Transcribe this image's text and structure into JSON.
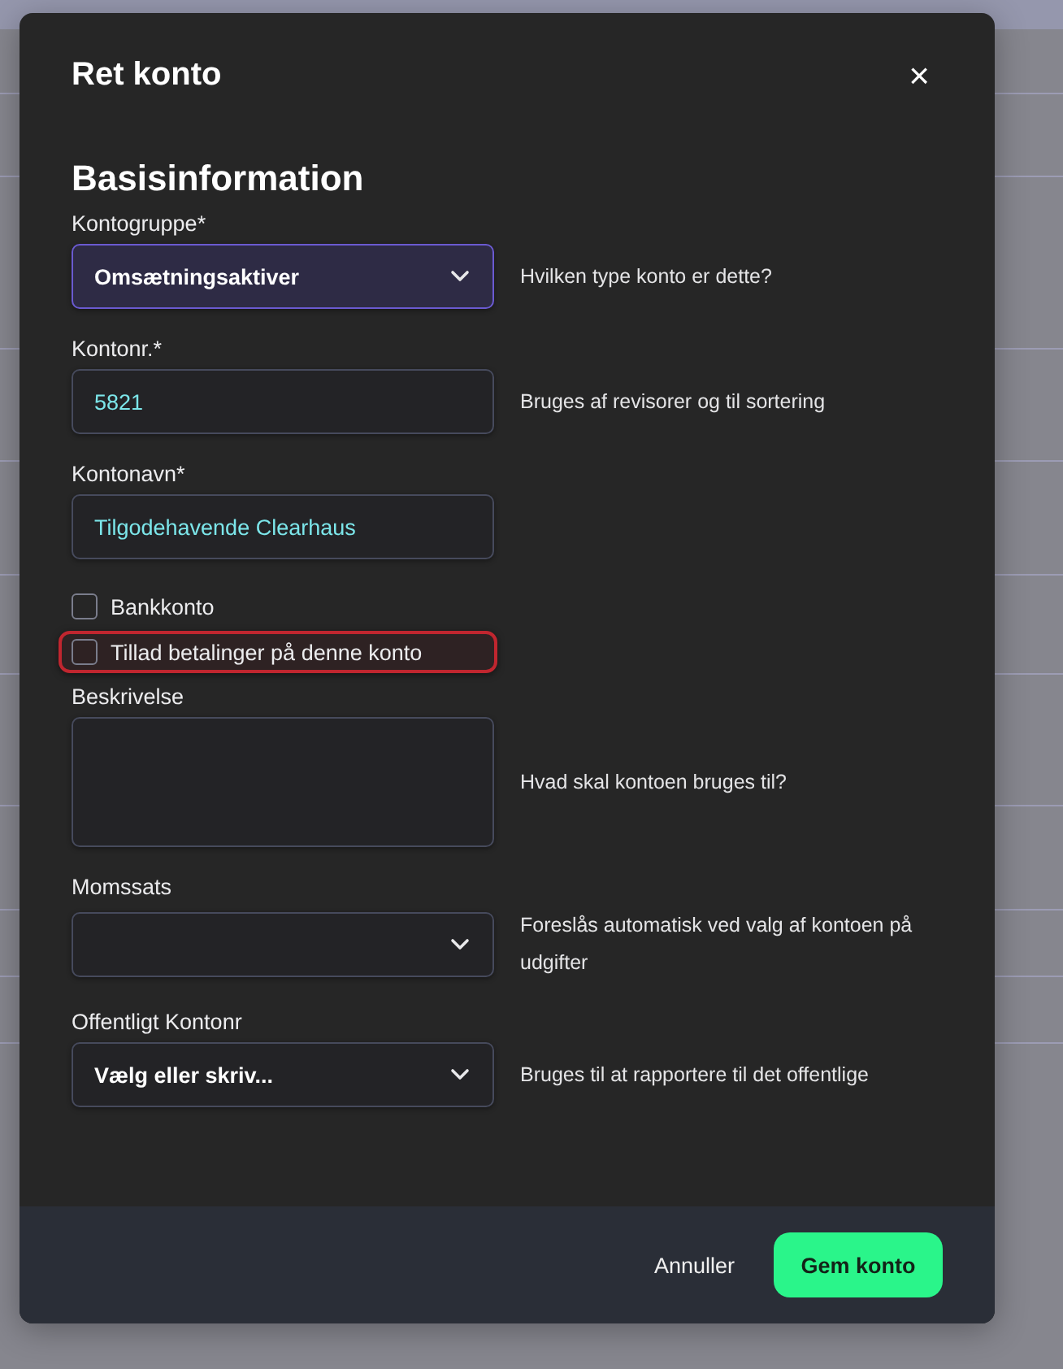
{
  "dialog": {
    "title": "Ret konto",
    "close": "×",
    "section": "Basisinformation",
    "fields": [
      {
        "kind": "select",
        "label": "Kontogruppe*",
        "value": "Omsætningsaktiver",
        "hint": "Hvilken type konto er dette?",
        "focused": true
      },
      {
        "kind": "text",
        "label": "Kontonr.*",
        "value": "5821",
        "hint": "Bruges af revisorer og til sortering",
        "focused": false
      },
      {
        "kind": "text",
        "label": "Kontonavn*",
        "value": "Tilgodehavende Clearhaus",
        "focused": false
      },
      {
        "kind": "checkbox",
        "label": "Bankkonto",
        "checked": false,
        "highlighted": false
      },
      {
        "kind": "checkbox",
        "label": "Tillad betalinger på denne konto",
        "checked": false,
        "highlighted": true
      },
      {
        "kind": "textarea",
        "label": "Beskrivelse",
        "hint": "Hvad skal kontoen bruges til?",
        "focused": false
      },
      {
        "kind": "select",
        "label": "Momssats",
        "hint": "Foreslås automatisk ved valg af kontoen på udgifter",
        "focused": false
      },
      {
        "kind": "select",
        "label": "Offentligt Kontonr",
        "placeholder": "Vælg eller skriv...",
        "hint": "Bruges til at rapportere til det offentlige",
        "focused": false
      }
    ],
    "buttons": [
      {
        "label": "Annuller",
        "kind": "secondary"
      },
      {
        "label": "Gem konto",
        "kind": "primary"
      }
    ]
  }
}
